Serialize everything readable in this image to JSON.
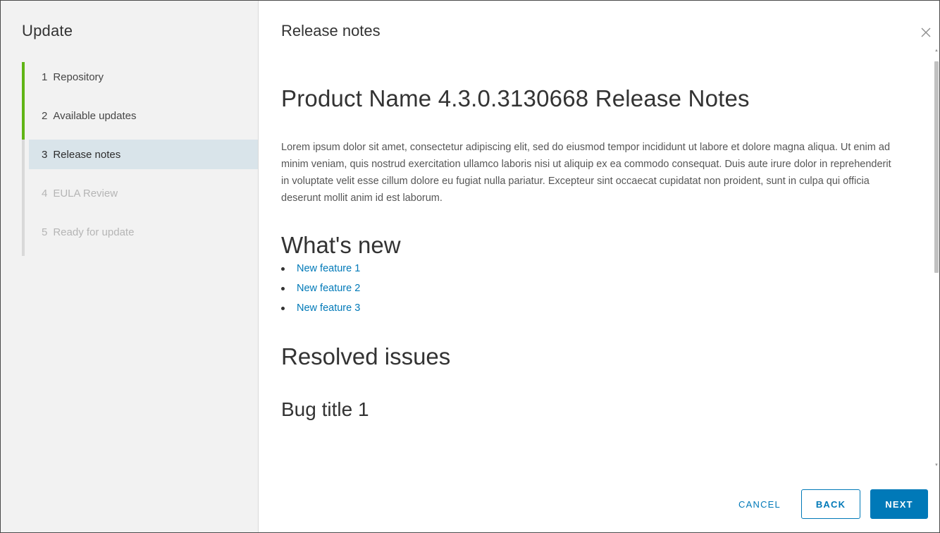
{
  "sidebar": {
    "title": "Update",
    "steps": [
      {
        "num": "1",
        "label": "Repository",
        "state": "complete"
      },
      {
        "num": "2",
        "label": "Available updates",
        "state": "complete"
      },
      {
        "num": "3",
        "label": "Release notes",
        "state": "current"
      },
      {
        "num": "4",
        "label": "EULA Review",
        "state": "disabled"
      },
      {
        "num": "5",
        "label": "Ready for update",
        "state": "disabled"
      }
    ]
  },
  "main": {
    "title": "Release notes",
    "close_icon": "close-icon",
    "doc": {
      "title": "Product Name 4.3.0.3130668 Release Notes",
      "intro": "Lorem ipsum dolor sit amet, consectetur adipiscing elit, sed do eiusmod tempor incididunt ut labore et dolore magna aliqua. Ut enim ad minim veniam, quis nostrud exercitation ullamco laboris nisi ut aliquip ex ea commodo consequat. Duis aute irure dolor in reprehenderit in voluptate velit esse cillum dolore eu fugiat nulla pariatur. Excepteur sint occaecat cupidatat non proident, sunt in culpa qui officia deserunt mollit anim id est laborum.",
      "whats_new_heading": "What's new",
      "features": [
        "New feature 1",
        "New feature 2",
        "New feature 3"
      ],
      "resolved_heading": "Resolved issues",
      "bug_title": "Bug title 1"
    }
  },
  "footer": {
    "cancel_label": "CANCEL",
    "back_label": "BACK",
    "next_label": "NEXT"
  },
  "colors": {
    "accent": "#0079b8",
    "complete": "#60b515",
    "current_bg": "#d9e4ea",
    "sidebar_bg": "#f2f2f2"
  }
}
